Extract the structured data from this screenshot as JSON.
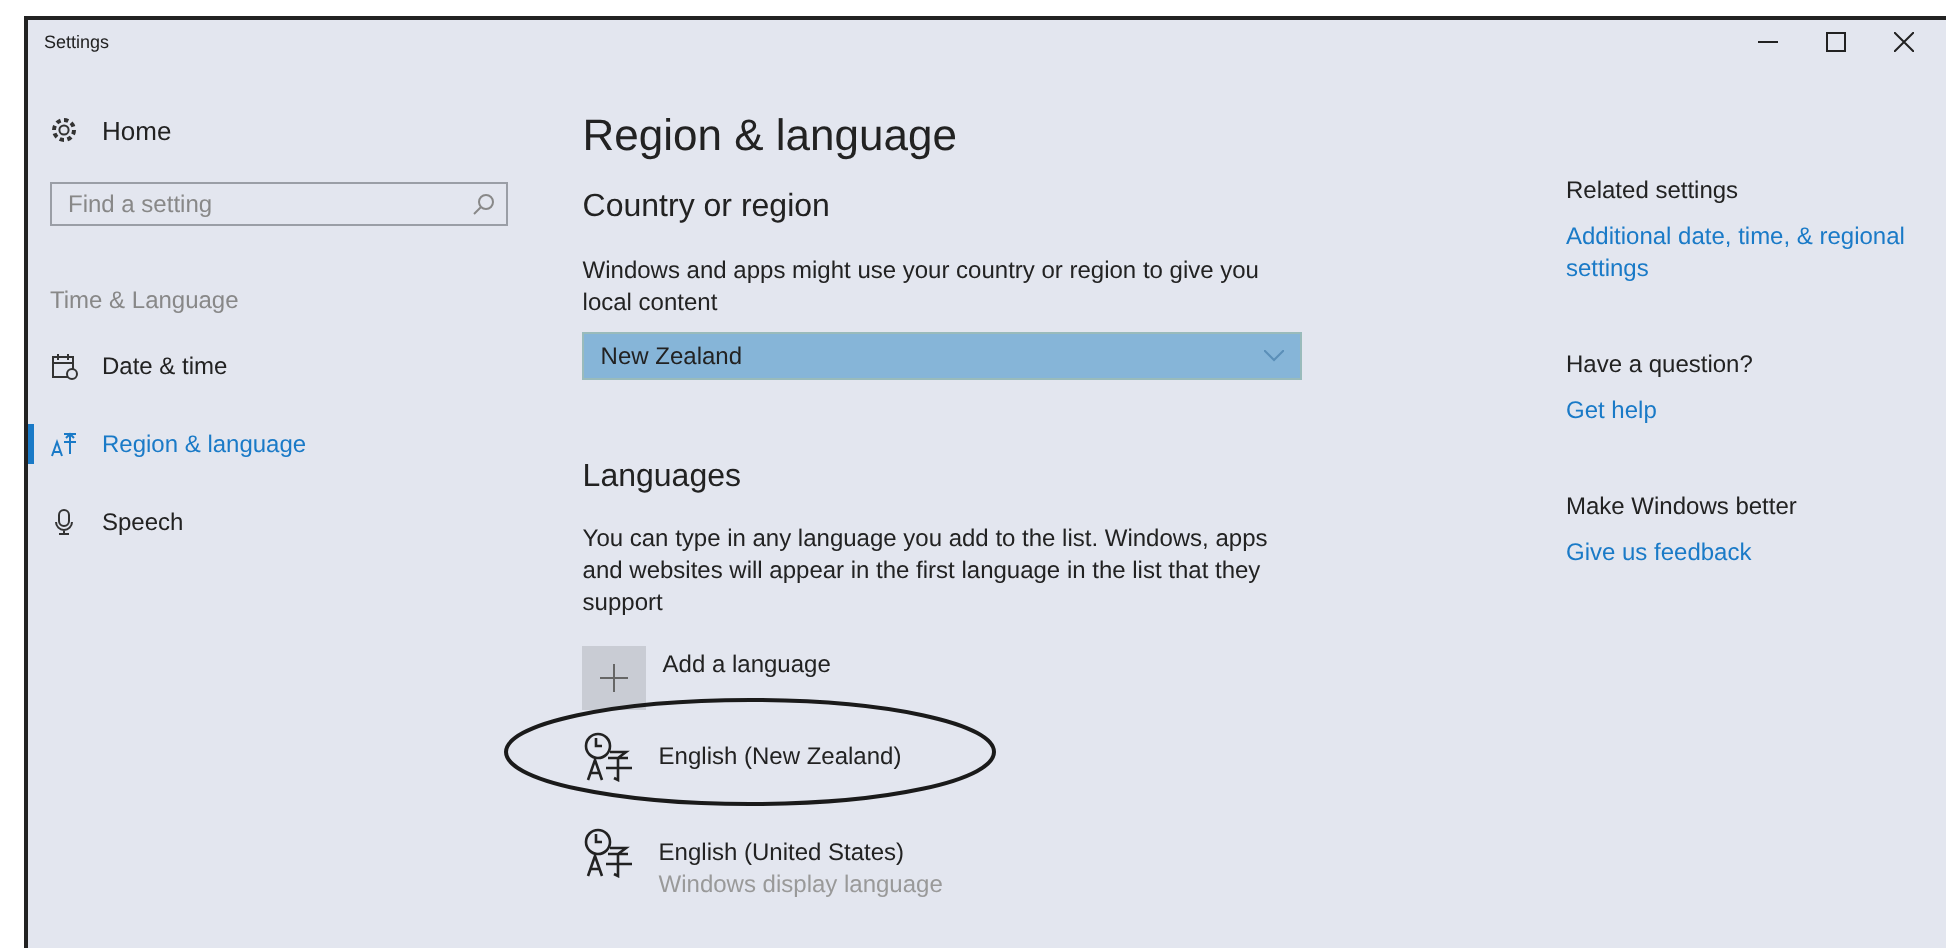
{
  "window": {
    "title": "Settings"
  },
  "sidebar": {
    "home": "Home",
    "search": {
      "placeholder": "Find a setting"
    },
    "section": "Time & Language",
    "items": [
      {
        "label": "Date & time",
        "selected": false
      },
      {
        "label": "Region & language",
        "selected": true
      },
      {
        "label": "Speech",
        "selected": false
      }
    ]
  },
  "main": {
    "title": "Region & language",
    "country": {
      "heading": "Country or region",
      "description": "Windows and apps might use your country or region to give you local content",
      "dropdown": {
        "value": "New Zealand"
      }
    },
    "languages": {
      "heading": "Languages",
      "description": "You can type in any language you add to the list. Windows, apps and websites will appear in the first language in the list that they support",
      "items": [
        {
          "kind": "add",
          "label": "Add a language"
        },
        {
          "kind": "language",
          "label": "English (New Zealand)",
          "circled": true
        },
        {
          "kind": "language",
          "label": "English (United States)",
          "subtitle": "Windows display language",
          "circled": false
        }
      ]
    }
  },
  "related": [
    {
      "heading": "Related settings",
      "link": "Additional date, time, & regional settings"
    },
    {
      "heading": "Have a question?",
      "link": "Get help"
    },
    {
      "heading": "Make Windows better",
      "link": "Give us feedback"
    }
  ]
}
